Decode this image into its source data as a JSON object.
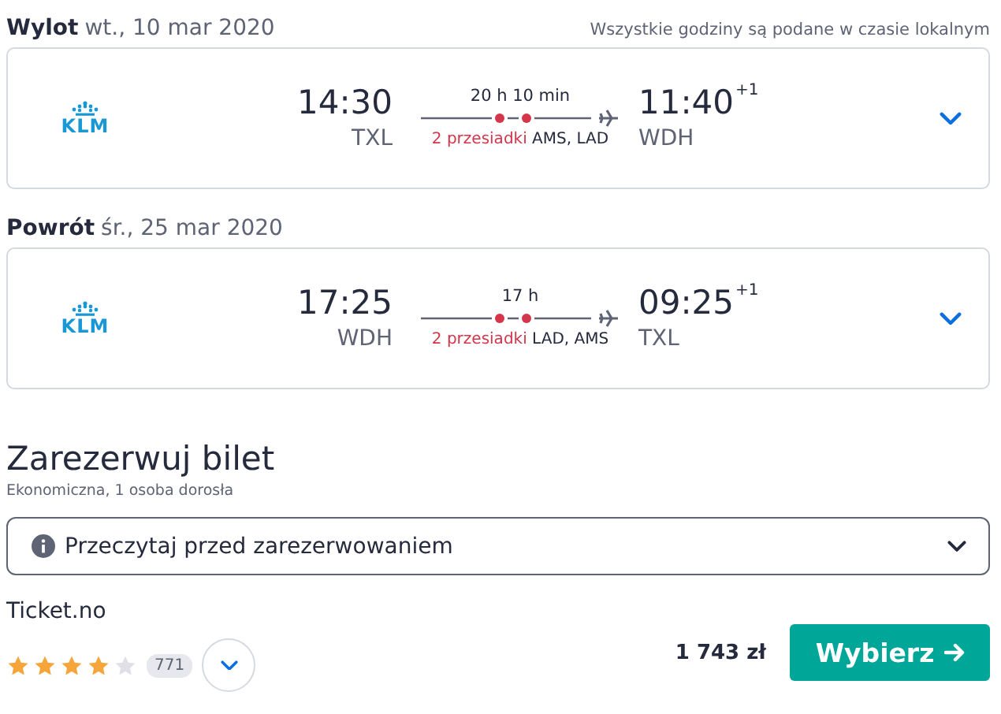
{
  "legs": [
    {
      "label": "Wylot",
      "date": "wt., 10 mar 2020",
      "note": "Wszystkie godziny są podane w czasie lokalnym",
      "airline": "KLM",
      "depart_time": "14:30",
      "depart_airport": "TXL",
      "duration": "20 h 10 min",
      "stops_count": "2 przesiadki",
      "stops": "AMS, LAD",
      "arrive_time": "11:40",
      "day_offset": "+1",
      "arrive_airport": "WDH",
      "expanded": false
    },
    {
      "label": "Powrót",
      "date": "śr., 25 mar 2020",
      "airline": "KLM",
      "depart_time": "17:25",
      "depart_airport": "WDH",
      "duration": "17 h",
      "stops_count": "2 przesiadki",
      "stops": "LAD, AMS",
      "arrive_time": "09:25",
      "day_offset": "+1",
      "arrive_airport": "TXL",
      "expanded": false
    }
  ],
  "booking": {
    "title": "Zarezerwuj bilet",
    "subtitle": "Ekonomiczna, 1 osoba dorosła",
    "info": {
      "label": "Przeczytaj przed zarezerwowaniem",
      "expanded": false
    },
    "provider": {
      "name": "Ticket.no",
      "stars": 4,
      "reviews": "771",
      "price": "1 743 zł",
      "button": "Wybierz"
    }
  }
}
